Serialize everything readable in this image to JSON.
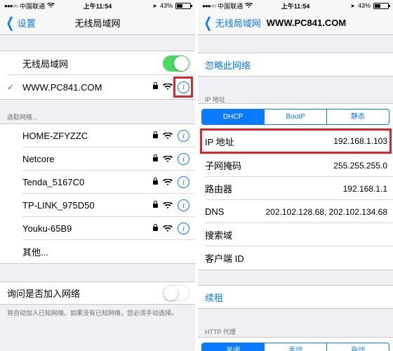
{
  "status_bar": {
    "carrier": "中国联通",
    "time": "上午11:54",
    "battery": "43%",
    "battery_level": 0.43
  },
  "left": {
    "nav": {
      "back_label": "设置",
      "title": "无线局域网"
    },
    "wlan_label": "无线局域网",
    "wlan_on": true,
    "connected_network": "WWW.PC841.COM",
    "choose_header": "选取网络...",
    "networks": [
      "HOME-ZFYZZC",
      "Netcore",
      "Tenda_5167C0",
      "TP-LINK_975D50",
      "Youku-65B9"
    ],
    "other_label": "其他...",
    "ask_label": "询问是否加入网络",
    "ask_on": false,
    "ask_footnote": "将自动加入已知网络。如果没有已知网络，您必须手动选择。"
  },
  "right": {
    "nav": {
      "back_label": "无线局域网",
      "title": "WWW.PC841.COM"
    },
    "forget_label": "忽略此网络",
    "ip_header": "IP 地址",
    "ip_modes": [
      "DHCP",
      "BootP",
      "静态"
    ],
    "ip_mode_selected": 0,
    "details": [
      {
        "label": "IP 地址",
        "value": "192.168.1.103"
      },
      {
        "label": "子网掩码",
        "value": "255.255.255.0"
      },
      {
        "label": "路由器",
        "value": "192.168.1.1"
      },
      {
        "label": "DNS",
        "value": "202.102.128.68, 202.102.134.68"
      },
      {
        "label": "搜索域",
        "value": ""
      },
      {
        "label": "客户端 ID",
        "value": ""
      }
    ],
    "renew_label": "续租",
    "http_proxy_header": "HTTP 代理",
    "proxy_modes": [
      "关闭",
      "手动",
      "自动"
    ],
    "proxy_mode_selected": 0
  },
  "colors": {
    "accent": "#0a7aff",
    "toggle_on": "#4cd964",
    "highlight": "#d9252b"
  }
}
